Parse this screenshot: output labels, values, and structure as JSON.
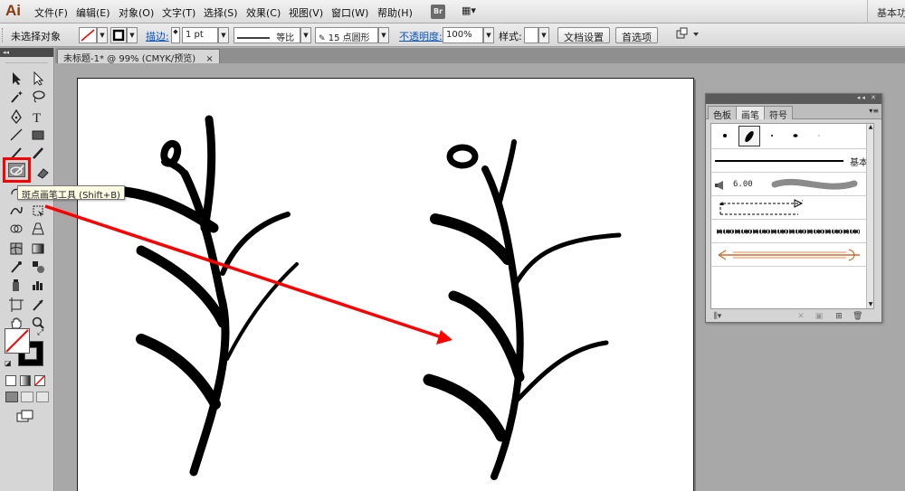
{
  "app": {
    "logo": "Ai",
    "workspace_label": "基本功能"
  },
  "menu": {
    "file": "文件(F)",
    "edit": "编辑(E)",
    "object": "对象(O)",
    "type": "文字(T)",
    "select": "选择(S)",
    "effect": "效果(C)",
    "view": "视图(V)",
    "window": "窗口(W)",
    "help": "帮助(H)",
    "bridge": "Br",
    "layout": "▦▾"
  },
  "control_bar": {
    "no_selection": "未选择对象",
    "stroke_link": "描边:",
    "stroke_weight": "1 pt",
    "profile_label": "等比",
    "brush_label": "15 点圆形",
    "opacity_link": "不透明度:",
    "opacity_value": "100%",
    "style_label": "样式:",
    "doc_setup_button": "文档设置",
    "preferences_button": "首选项"
  },
  "document": {
    "tab_title": "未标题-1* @ 99% (CMYK/预览)",
    "close": "×"
  },
  "toolbox": {
    "collapse": "◂◂",
    "tooltip": "斑点画笔工具 (Shift+B)"
  },
  "brush_panel": {
    "tabs": [
      "色板",
      "画笔",
      "符号"
    ],
    "active_tab": "画笔",
    "collapse": "◂◂ ✕",
    "menu": "▾≡",
    "basic_label": "基本",
    "size_value": "6.00"
  },
  "colors": {
    "annotation_red": "#ff0000",
    "ink": "#000000",
    "link_blue": "#0b55c4",
    "ai_brand": "#8a3a0c"
  }
}
